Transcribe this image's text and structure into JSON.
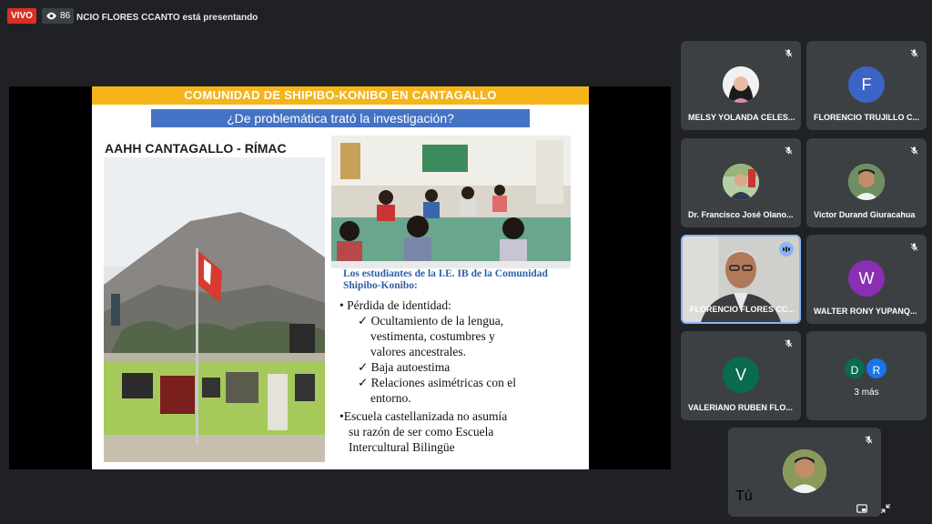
{
  "header": {
    "live_label": "VIVO",
    "viewer_count": "86",
    "presenting_text": "NCIO FLORES CCANTO está presentando"
  },
  "slide": {
    "title": "COMUNIDAD DE SHIPIBO-KONIBO EN CANTAGALLO",
    "question": "¿De problemática trató la investigación?",
    "place": "AAHH CANTAGALLO - RÍMAC",
    "body_heading": "Los estudiantes de la I.E. IB de la Comunidad Shipibo-Konibo:",
    "bullet1": "• Pérdida de identidad:",
    "check1a": "✓ Ocultamiento de la lengua,",
    "check1b": "vestimenta, costumbres y",
    "check1c": "valores ancestrales.",
    "check2": "✓ Baja autoestima",
    "check3a": "✓ Relaciones asimétricas con el",
    "check3b": "entorno.",
    "bullet2a": "•Escuela castellanizada no asumía",
    "bullet2b": "su razón de ser como Escuela",
    "bullet2c": "Intercultural Bilingüe"
  },
  "participants": [
    {
      "name": "MELSY YOLANDA CELES..."
    },
    {
      "name": "FLORENCIO TRUJILLO C...",
      "initial": "F",
      "color": "#3c63c6"
    },
    {
      "name": "Dr. Francisco José Olano..."
    },
    {
      "name": "Victor Durand Giuracahua"
    },
    {
      "name": "FLORENCIO FLORES CC..."
    },
    {
      "name": "WALTER RONY YUPANQ...",
      "initial": "W",
      "color": "#8a2fb3"
    },
    {
      "name": "VALERIANO RUBEN FLO...",
      "initial": "V",
      "color": "#0b6b4f"
    }
  ],
  "more": {
    "initials": [
      "D",
      "R"
    ],
    "label": "3 más",
    "colors": [
      "#0b6b4f",
      "#1a73e8"
    ]
  },
  "self": {
    "name": "Tú"
  }
}
